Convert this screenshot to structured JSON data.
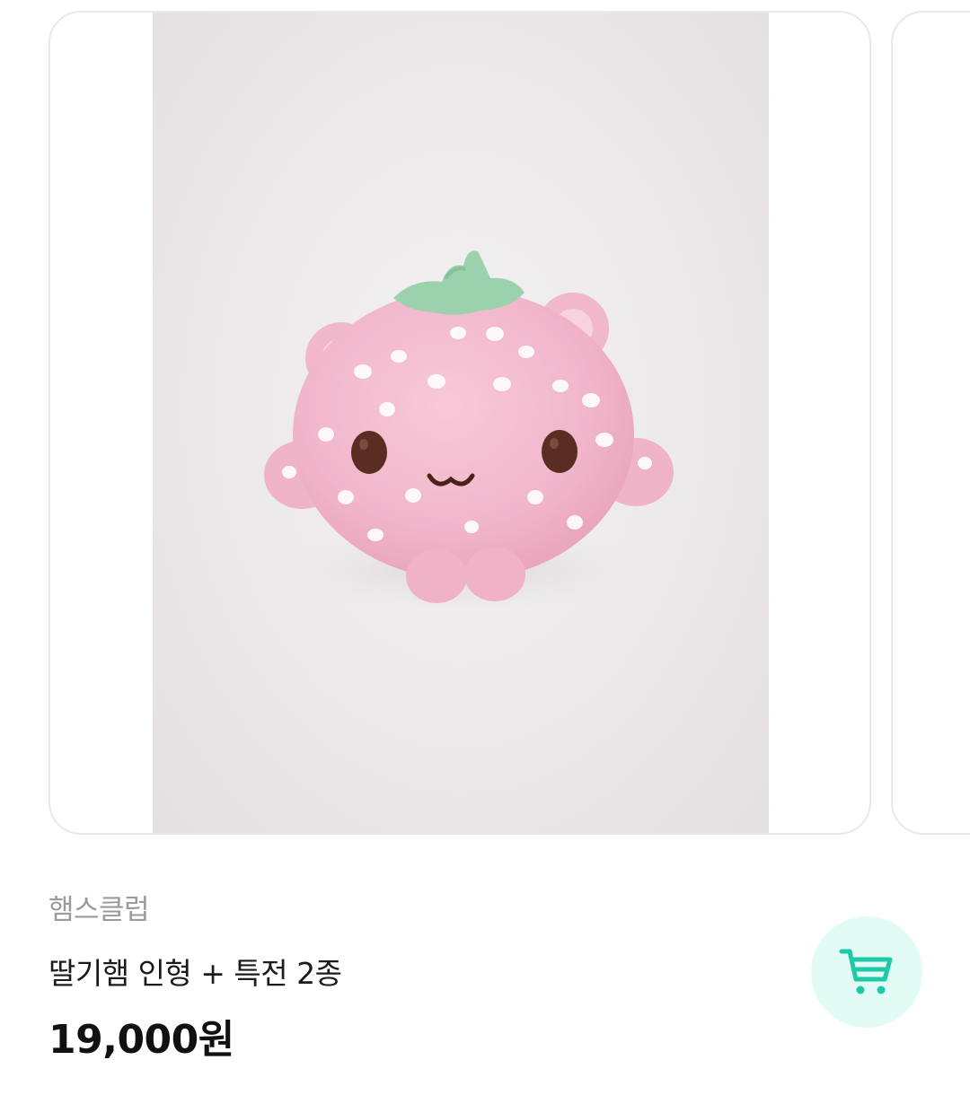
{
  "product": {
    "shop_name": "햄스클럽",
    "title": "딸기햄 인형 + 특전 2종",
    "price": "19,000원"
  },
  "image": {
    "subject": "strawberry-hamster-plush"
  },
  "cart": {
    "icon": "cart-icon",
    "accent_color": "#1fc9a7",
    "bg_color": "#e2fbf5"
  }
}
